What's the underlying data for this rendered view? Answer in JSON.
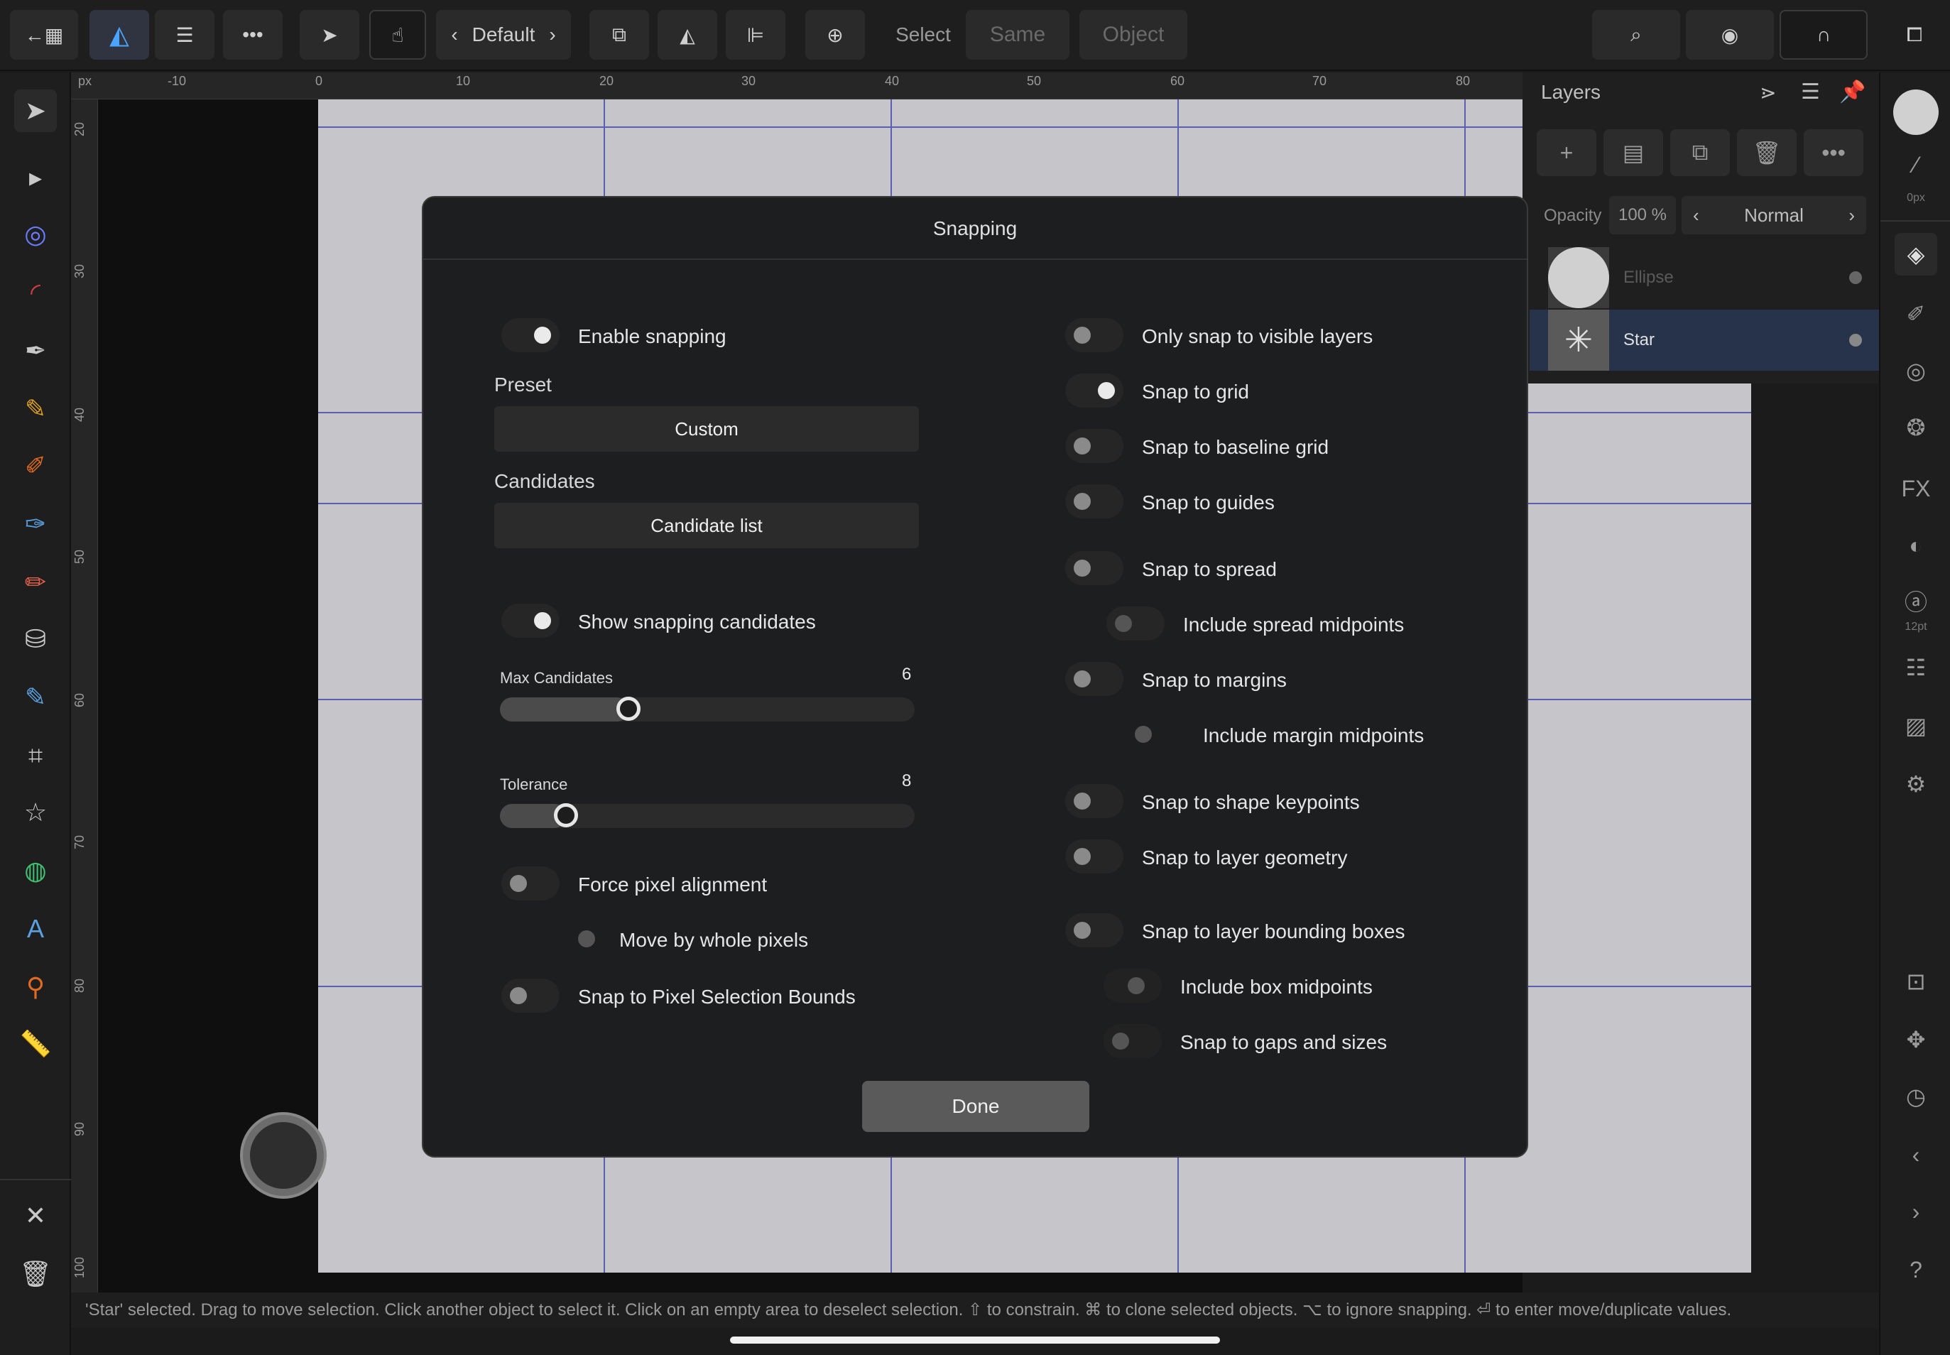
{
  "toolbar": {
    "persona_label": "Default",
    "select_label": "Select",
    "same_label": "Same",
    "object_label": "Object"
  },
  "rulers": {
    "unit": "px",
    "top_ticks": [
      "-10",
      "0",
      "10",
      "20",
      "30",
      "40",
      "50",
      "60",
      "70",
      "80"
    ],
    "left_ticks": [
      "20",
      "30",
      "40",
      "50",
      "60",
      "70",
      "80",
      "90",
      "100"
    ]
  },
  "layers": {
    "title": "Layers",
    "opacity_label": "Opacity",
    "opacity_value": "100 %",
    "blend_mode": "Normal",
    "items": [
      {
        "name": "Ellipse",
        "selected": false
      },
      {
        "name": "Star",
        "selected": true
      }
    ]
  },
  "right_strip": {
    "brush_size": "0px",
    "text_size": "12pt"
  },
  "snapping": {
    "title": "Snapping",
    "enable_snapping": {
      "label": "Enable snapping",
      "on": true
    },
    "preset_label": "Preset",
    "preset_value": "Custom",
    "candidates_label": "Candidates",
    "candidates_value": "Candidate list",
    "show_candidates": {
      "label": "Show snapping candidates",
      "on": true
    },
    "max_candidates": {
      "label": "Max Candidates",
      "value": "6",
      "fraction": 0.28
    },
    "tolerance": {
      "label": "Tolerance",
      "value": "8",
      "fraction": 0.13
    },
    "force_pixel_alignment": {
      "label": "Force pixel alignment",
      "on": false
    },
    "move_by_whole_pixels": {
      "label": "Move by whole pixels",
      "on": false
    },
    "snap_pixel_selection": {
      "label": "Snap to Pixel Selection Bounds",
      "on": false
    },
    "right_options": [
      {
        "label": "Only snap to visible layers",
        "on": false
      },
      {
        "label": "Snap to grid",
        "on": true
      },
      {
        "label": "Snap to baseline grid",
        "on": false
      },
      {
        "label": "Snap to guides",
        "on": false
      },
      {
        "label": "Snap to spread",
        "on": false
      },
      {
        "label": "Include spread midpoints",
        "on": false
      },
      {
        "label": "Snap to margins",
        "on": false
      },
      {
        "label": "Include margin midpoints",
        "on": false
      },
      {
        "label": "Snap to shape keypoints",
        "on": false
      },
      {
        "label": "Snap to layer geometry",
        "on": false
      },
      {
        "label": "Snap to layer bounding boxes",
        "on": false
      },
      {
        "label": "Include box midpoints",
        "on": false
      },
      {
        "label": "Snap to gaps and sizes",
        "on": false
      }
    ],
    "done_label": "Done"
  },
  "status": {
    "text": "'Star' selected. Drag to move selection. Click another object to select it. Click on an empty area to deselect selection. ⇧ to constrain. ⌘ to clone selected objects. ⌥ to ignore snapping. ⏎ to enter move/duplicate values."
  }
}
